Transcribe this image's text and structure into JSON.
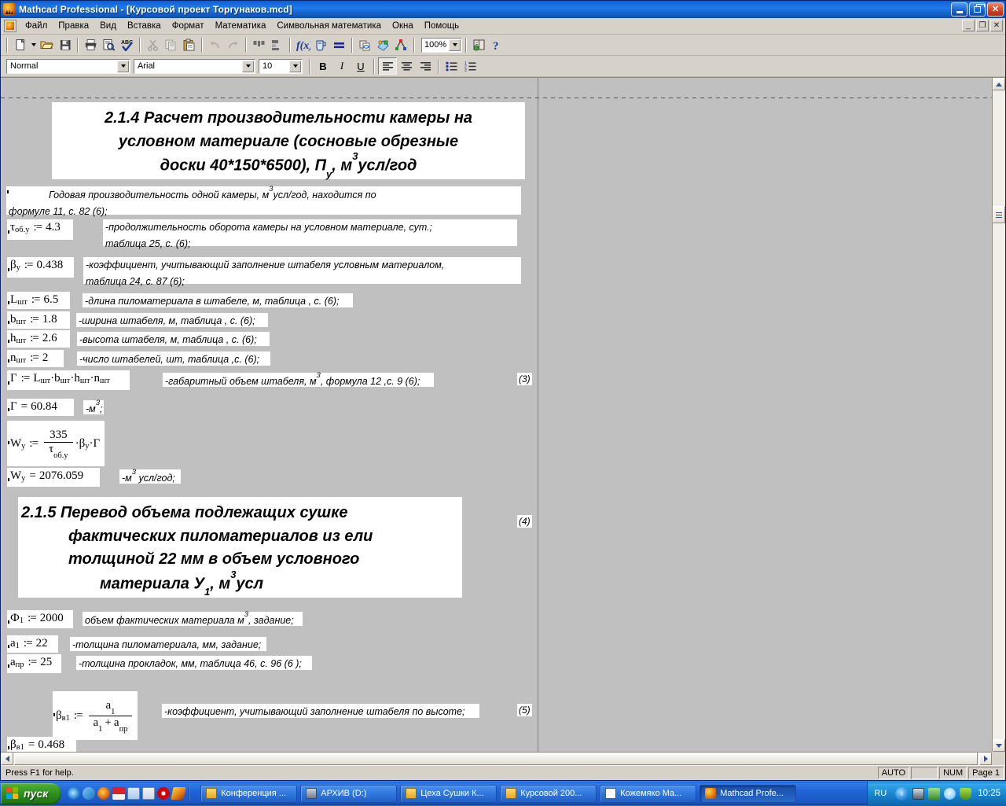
{
  "window": {
    "title": "Mathcad Professional - [Курсовой проект Торгунаков.mcd]",
    "icon": "mathcad-icon",
    "minimize_label": "",
    "restore_label": "",
    "close_label": "✕"
  },
  "menu": {
    "items": [
      {
        "label": "Файл",
        "name": "menu-file"
      },
      {
        "label": "Правка",
        "name": "menu-edit"
      },
      {
        "label": "Вид",
        "name": "menu-view"
      },
      {
        "label": "Вставка",
        "name": "menu-insert"
      },
      {
        "label": "Формат",
        "name": "menu-format"
      },
      {
        "label": "Математика",
        "name": "menu-math"
      },
      {
        "label": "Символьная математика",
        "name": "menu-symbolic"
      },
      {
        "label": "Окна",
        "name": "menu-windows"
      },
      {
        "label": "Помощь",
        "name": "menu-help"
      }
    ],
    "mdi_minimize": "_",
    "mdi_restore": "❐",
    "mdi_close": "✕"
  },
  "toolbar": {
    "zoom_value": "100%",
    "buttons": [
      "new-document-icon",
      "new-document-dropdown-icon",
      "open-folder-icon",
      "save-disk-icon",
      "print-icon",
      "print-preview-icon",
      "spell-check-icon",
      "cut-scissors-icon",
      "copy-icon",
      "paste-clipboard-icon",
      "undo-icon",
      "redo-icon",
      "align-across-icon",
      "align-down-icon",
      "insert-function-icon",
      "insert-unit-icon",
      "calculate-equals-icon",
      "insert-hyperlink-icon",
      "insert-component-icon",
      "resource-center-icon",
      "help-book-icon",
      "context-help-icon"
    ]
  },
  "formatbar": {
    "style": "Normal",
    "font": "Arial",
    "size": "10",
    "bold_label": "B",
    "italic_label": "I",
    "underline_label": "U",
    "align_left": "align-left-icon",
    "align_center": "align-center-icon",
    "align_right": "align-right-icon",
    "bullet_list": "bullet-list-icon",
    "number_list": "numbered-list-icon"
  },
  "document": {
    "heading_214": {
      "lines": [
        "2.1.4 Расчет производительности камеры на",
        "условном материале (сосновые обрезные",
        "доски 40*150*6500), Пу, м³усл/год"
      ],
      "line3_pre": "доски 40*150*6500), П",
      "line3_sub": "у",
      "line3_mid": ", м",
      "line3_sup": "3",
      "line3_post": "усл/год"
    },
    "intro_text": {
      "line1": "Годовая производительность одной камеры, м³усл/год, находится по",
      "line1_a": "Годовая производительность одной камеры, м",
      "line1_sup": "3",
      "line1_b": "усл/год, находится по",
      "line2": "формуле 11, с. 82 (6);"
    },
    "definitions": [
      {
        "name": "tau-ob-y",
        "var": "τ",
        "sub": "об.у",
        "op": ":=",
        "value": "4.3",
        "comment_line1": "-продолжительность оборота камеры на условном материале, сут.;",
        "comment_line2": "таблица 25, с. (6);"
      },
      {
        "name": "beta-y",
        "var": "β",
        "sub": "у",
        "op": ":=",
        "value": "0.438",
        "comment_line1": "-коэффициент, учитывающий  заполнение штабеля условным материалом,",
        "comment_line2": "таблица 24, с. 87  (6);"
      },
      {
        "name": "L-sht",
        "var": "L",
        "sub": "шт",
        "op": ":=",
        "value": "6.5",
        "comment_line1": "-длина пиломатериала в штабеле, м, таблица , с.  (6);",
        "comment_line2": ""
      },
      {
        "name": "b-sht",
        "var": "b",
        "sub": "шт",
        "op": ":=",
        "value": "1.8",
        "comment_line1": "-ширина штабеля, м, таблица , с.  (6);",
        "comment_line2": ""
      },
      {
        "name": "h-sht",
        "var": "h",
        "sub": "шт",
        "op": ":=",
        "value": "2.6",
        "comment_line1": "-высота штабеля, м, таблица , с.  (6);",
        "comment_line2": ""
      },
      {
        "name": "n-sht",
        "var": "n",
        "sub": "шт",
        "op": ":=",
        "value": "2",
        "comment_line1": "-число штабелей, шт, таблица ,с. (6);",
        "comment_line2": ""
      }
    ],
    "gamma_formula": {
      "lhs": "Г",
      "op": ":=",
      "rhs_parts": [
        {
          "var": "L",
          "sub": "шт"
        },
        {
          "var": "b",
          "sub": "шт"
        },
        {
          "var": "h",
          "sub": "шт"
        },
        {
          "var": "n",
          "sub": "шт"
        }
      ],
      "comment": "-габаритный объем штабеля, м³, формула 12 ,с. 9 (6);",
      "comment_a": "-габаритный объем штабеля, м",
      "comment_sup": "3",
      "comment_b": ", формула 12 ,с. 9 (6);",
      "eqnum": "(3)"
    },
    "gamma_result": {
      "lhs": "Г",
      "op": "=",
      "value": "60.84",
      "unit": "-м³;",
      "unit_a": "-м",
      "unit_sup": "3",
      "unit_b": ";"
    },
    "wy_formula": {
      "lhs": "W",
      "lhs_sub": "у",
      "op": ":=",
      "num": "335",
      "den_var": "τ",
      "den_sub": "об.у",
      "mult1_var": "β",
      "mult1_sub": "у",
      "mult2": "Г",
      "eqnum": "(4)"
    },
    "wy_result": {
      "lhs": "W",
      "lhs_sub": "у",
      "op": "=",
      "value": "2076.059",
      "unit": "-м³ усл/год;",
      "unit_a": "-м",
      "unit_sup": "3",
      "unit_b": " усл/год;"
    },
    "heading_215": {
      "lines": [
        "2.1.5 Перевод объема подлежащих сушке",
        "фактических пиломатериалов из ели",
        "толщиной 22 мм в объем условного",
        "материала У1, м³усл"
      ],
      "line4_pre": "материала У",
      "line4_sub": "1",
      "line4_mid": ", м",
      "line4_sup": "3",
      "line4_post": "усл"
    },
    "definitions2": [
      {
        "name": "phi-1",
        "var": "Ф",
        "sub": "1",
        "op": ":=",
        "value": "2000",
        "comment_a": "объем фактических материала м",
        "comment_sup": "3",
        "comment_b": ", задание;"
      },
      {
        "name": "a-1",
        "var": "a",
        "sub": "1",
        "op": ":=",
        "value": "22",
        "comment_a": "-толщина пиломатериала, мм, задание;",
        "comment_sup": "",
        "comment_b": ""
      },
      {
        "name": "a-pr",
        "var": "a",
        "sub": "пр",
        "op": ":=",
        "value": "25",
        "comment_a": "-толщина прокладок, мм, таблица 46, с. 96 (6 );",
        "comment_sup": "",
        "comment_b": ""
      }
    ],
    "beta_v1_formula": {
      "lhs": "β",
      "lhs_sub": "в1",
      "op": ":=",
      "num_var": "a",
      "num_sub": "1",
      "den_var1": "a",
      "den_sub1": "1",
      "den_plus": "+",
      "den_var2": "a",
      "den_sub2": "пр",
      "comment": "-коэффициент, учитывающий заполнение штабеля по высоте;",
      "eqnum": "(5)"
    },
    "beta_v1_result": {
      "lhs": "β",
      "lhs_sub": "в1",
      "op": "=",
      "value": "0.468"
    }
  },
  "statusbar": {
    "message": "Press F1 for help.",
    "auto": "AUTO",
    "blank": "",
    "num": "NUM",
    "page": "Page 1"
  },
  "taskbar": {
    "start_label": "пуск",
    "quicklaunch": [
      "internet-explorer-icon",
      "outlook-express-icon",
      "media-player-icon",
      "save-disk-icon",
      "calculator-icon",
      "ie-document-icon",
      "opera-icon",
      "mathcad-quick-icon"
    ],
    "tasks": [
      {
        "label": "Конференция ...",
        "icon": "folder-icon",
        "active": false,
        "name": "taskbar-item-konferenciya"
      },
      {
        "label": "АРХИВ (D:)",
        "icon": "drive-icon",
        "active": false,
        "name": "taskbar-item-arhiv"
      },
      {
        "label": "Цеха Сушки К...",
        "icon": "folder-icon",
        "active": false,
        "name": "taskbar-item-ceha-sushki"
      },
      {
        "label": "Курсовой 200...",
        "icon": "folder-icon",
        "active": false,
        "name": "taskbar-item-kursovoy"
      },
      {
        "label": "Кожемяко Ма...",
        "icon": "word-doc-icon",
        "active": false,
        "name": "taskbar-item-kozhemyako"
      },
      {
        "label": "Mathcad Profe...",
        "icon": "mathcad-icon",
        "active": true,
        "name": "taskbar-item-mathcad"
      }
    ],
    "lang": "RU",
    "tray_chevron": "‹",
    "tray_icons": [
      "network-icon",
      "volume-icon",
      "update-icon",
      "antivirus-shield-icon"
    ],
    "clock": "10:25"
  }
}
